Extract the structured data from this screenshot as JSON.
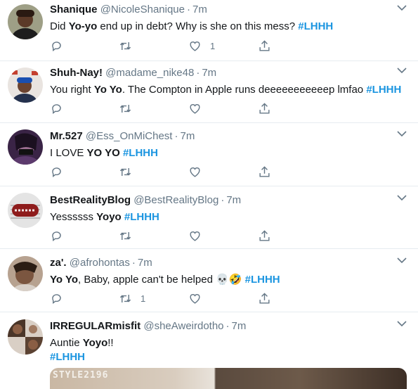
{
  "tweets": [
    {
      "name": "Shanique",
      "handle": "@NicoleShanique",
      "time": "7m",
      "text_parts": [
        "Did ",
        "Yo-yo",
        " end up in debt? Why is she on this mess?  ",
        "#LHHH"
      ],
      "reply_count": "",
      "retweet_count": "",
      "like_count": "1"
    },
    {
      "name": "Shuh-Nay!",
      "handle": "@madame_nike48",
      "time": "7m",
      "text_parts": [
        "You right ",
        "Yo Yo",
        ". The Compton in Apple runs deeeeeeeeeeep lmfao ",
        "#LHHH"
      ],
      "reply_count": "",
      "retweet_count": "",
      "like_count": ""
    },
    {
      "name": "Mr.527",
      "handle": "@Ess_OnMiChest",
      "time": "7m",
      "text_parts": [
        "I LOVE ",
        "YO YO",
        " ",
        "#LHHH"
      ],
      "reply_count": "",
      "retweet_count": "",
      "like_count": ""
    },
    {
      "name": "BestRealityBlog",
      "handle": "@BestRealityBlog",
      "time": "7m",
      "text_parts": [
        "Yessssss ",
        "Yoyo",
        " ",
        "#LHHH"
      ],
      "reply_count": "",
      "retweet_count": "",
      "like_count": ""
    },
    {
      "name": "za'.",
      "handle": "@afrohontas",
      "time": "7m",
      "text_parts": [
        "Yo Yo",
        ", Baby, apple can't be helped 💀🤣 ",
        "#LHHH"
      ],
      "reply_count": "",
      "retweet_count": "1",
      "like_count": ""
    },
    {
      "name": "IRREGULARmisfit",
      "handle": "@sheAweirdotho",
      "time": "7m",
      "text_line1": [
        "Auntie ",
        "Yoyo",
        "!!"
      ],
      "text_line2": "#LHHH",
      "media_caption": "STYLE2196"
    }
  ],
  "icons": {
    "reply": "reply-icon",
    "retweet": "retweet-icon",
    "like": "heart-icon",
    "share": "share-icon",
    "menu": "chevron-down-icon"
  },
  "colors": {
    "hashtag": "#1b95e0",
    "secondary_text": "#657786",
    "divider": "#e6ecf0"
  }
}
